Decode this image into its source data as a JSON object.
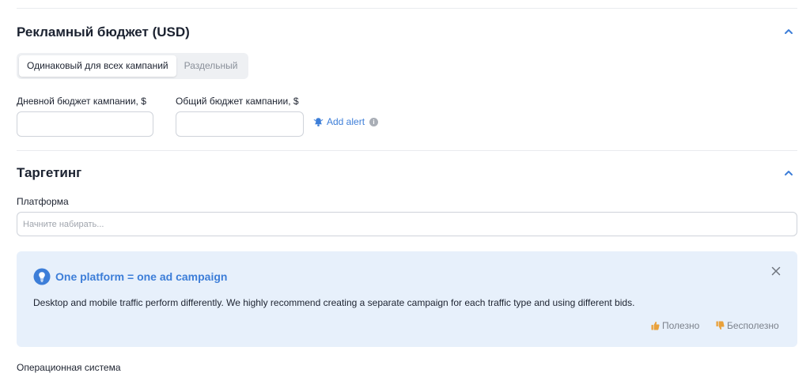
{
  "budget": {
    "title": "Рекламный бюджет (USD)",
    "modes": [
      {
        "label": "Одинаковый для всех кампаний",
        "active": true
      },
      {
        "label": "Раздельный",
        "active": false
      }
    ],
    "daily_label": "Дневной бюджет кампании, $",
    "daily_value": "",
    "total_label": "Общий бюджет кампании, $",
    "total_value": "",
    "add_alert_label": "Add alert",
    "info_symbol": "i"
  },
  "targeting": {
    "title": "Таргетинг",
    "platform_label": "Платформа",
    "platform_placeholder": "Начните набирать...",
    "os_label": "Операционная система"
  },
  "notice": {
    "title": "One platform = one ad campaign",
    "text": "Desktop and mobile traffic perform differently. We highly recommend creating a separate campaign for each traffic type and using different bids.",
    "useful_label": "Полезно",
    "useless_label": "Бесполезно"
  },
  "icons": {
    "collapse": "chevron-up-icon",
    "alert": "bell-icon",
    "info": "info-icon",
    "notice": "lightbulb-icon",
    "close": "close-icon",
    "useful": "thumbs-up-icon",
    "useless": "thumbs-down-icon"
  },
  "colors": {
    "accent": "#3d7ed8",
    "notice_bg": "#e7f0fb",
    "feedback_icon": "#e9a13b"
  }
}
